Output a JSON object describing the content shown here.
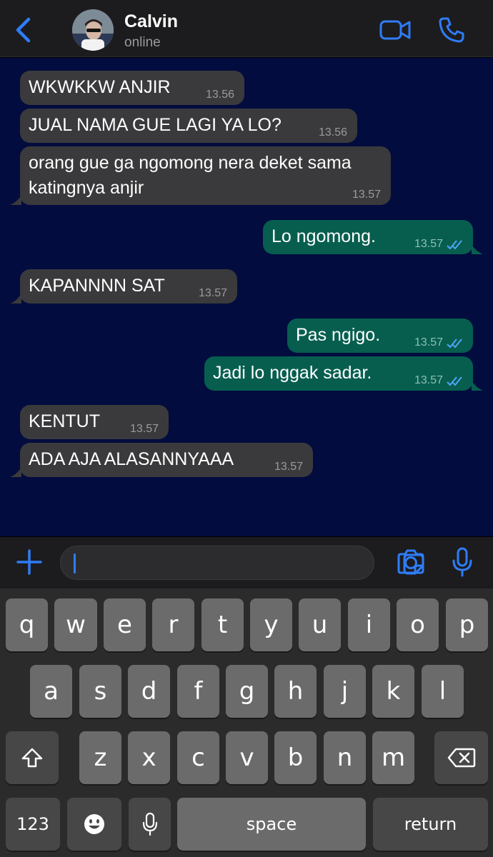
{
  "header": {
    "contact_name": "Calvin",
    "status": "online",
    "icons": {
      "back": "chevron-left-icon",
      "video": "video-call-icon",
      "call": "phone-icon"
    }
  },
  "colors": {
    "chat_background": "#020c3e",
    "incoming_bubble": "#3a3a3c",
    "outgoing_bubble": "#075e4f",
    "accent": "#2f7cf6"
  },
  "messages": [
    {
      "direction": "in",
      "text": "WKWKKW ANJIR",
      "time": "13.56"
    },
    {
      "direction": "in",
      "text": "JUAL NAMA GUE LAGI YA LO?",
      "time": "13.56"
    },
    {
      "direction": "in",
      "text": "orang gue ga ngomong nera deket sama\nkatingnya anjir",
      "time": "13.57"
    },
    {
      "direction": "out",
      "text": "Lo ngomong.",
      "time": "13.57",
      "status": "read"
    },
    {
      "direction": "in",
      "text": "KAPANNNN SAT",
      "time": "13.57"
    },
    {
      "direction": "out",
      "text": "Pas ngigo.",
      "time": "13.57",
      "status": "read"
    },
    {
      "direction": "out",
      "text": "Jadi lo nggak sadar.",
      "time": "13.57",
      "status": "read"
    },
    {
      "direction": "in",
      "text": "KENTUT",
      "time": "13.57"
    },
    {
      "direction": "in",
      "text": "ADA AJA ALASANNYAAA",
      "time": "13.57"
    }
  ],
  "composer": {
    "value": "",
    "icons": {
      "add": "plus-icon",
      "sticker": "sticker-icon",
      "camera": "camera-icon",
      "mic": "microphone-icon"
    }
  },
  "keyboard": {
    "row1": [
      "q",
      "w",
      "e",
      "r",
      "t",
      "y",
      "u",
      "i",
      "o",
      "p"
    ],
    "row2": [
      "a",
      "s",
      "d",
      "f",
      "g",
      "h",
      "j",
      "k",
      "l"
    ],
    "row3": [
      "z",
      "x",
      "c",
      "v",
      "b",
      "n",
      "m"
    ],
    "numbers_label": "123",
    "space_label": "space",
    "return_label": "return",
    "icons": {
      "shift": "shift-icon",
      "delete": "delete-icon",
      "emoji": "emoji-icon",
      "dictation": "microphone-icon"
    }
  }
}
